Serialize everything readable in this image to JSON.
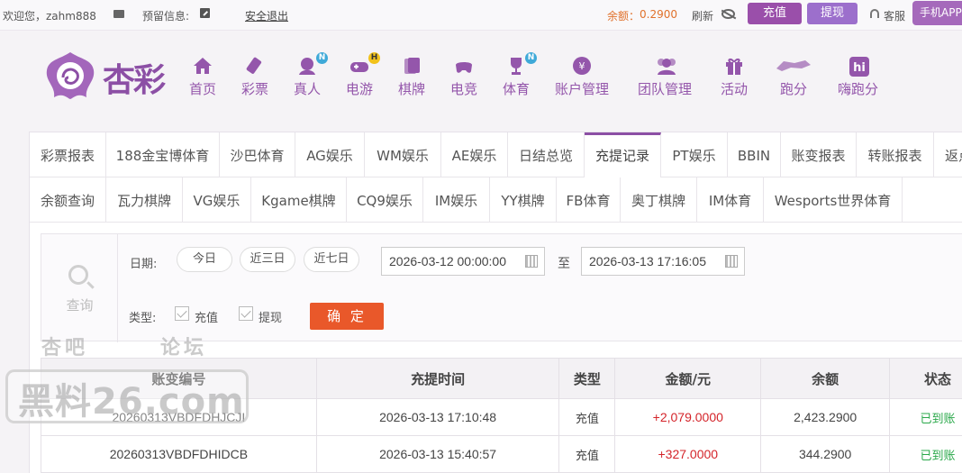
{
  "topbar": {
    "welcome": "欢迎您，zahm888",
    "reserve_label": "预留信息:",
    "logout": "安全退出",
    "balance_label": "余额：",
    "balance_value": "0.2900",
    "refresh": "刷新",
    "recharge": "充值",
    "withdraw": "提现",
    "service": "客服",
    "app": "手机APP"
  },
  "brand": {
    "name": "杏彩"
  },
  "nav": [
    {
      "label": "首页",
      "icon": "home-icon"
    },
    {
      "label": "彩票",
      "icon": "lottery-ticket-icon"
    },
    {
      "label": "真人",
      "icon": "live-dealer-icon",
      "badge": "N"
    },
    {
      "label": "电游",
      "icon": "gamepad-icon",
      "badge": "H"
    },
    {
      "label": "棋牌",
      "icon": "cards-icon"
    },
    {
      "label": "电竞",
      "icon": "esports-icon"
    },
    {
      "label": "体育",
      "icon": "trophy-icon",
      "badge": "N"
    },
    {
      "label": "账户管理",
      "icon": "account-icon"
    },
    {
      "label": "团队管理",
      "icon": "team-icon"
    },
    {
      "label": "活动",
      "icon": "gift-icon"
    },
    {
      "label": "跑分",
      "icon": "running-icon"
    },
    {
      "label": "嗨跑分",
      "icon": "hi-icon"
    }
  ],
  "tabs_row1": [
    "彩票报表",
    "188金宝博体育",
    "沙巴体育",
    "AG娱乐",
    "WM娱乐",
    "AE娱乐",
    "日结总览",
    "充提记录",
    "PT娱乐",
    "BBIN",
    "账变报表",
    "转账报表",
    "返点"
  ],
  "tabs_row2": [
    "余额查询",
    "瓦力棋牌",
    "VG娱乐",
    "Kgame棋牌",
    "CQ9娱乐",
    "IM娱乐",
    "YY棋牌",
    "FB体育",
    "奥丁棋牌",
    "IM体育",
    "Wesports世界体育"
  ],
  "active_tab": "充提记录",
  "search": {
    "side_label": "查询",
    "date_label": "日期:",
    "quick_ranges": [
      "今日",
      "近三日",
      "近七日"
    ],
    "start": "2026-03-12 00:00:00",
    "to": "至",
    "end": "2026-03-13 17:16:05",
    "type_label": "类型:",
    "types": [
      "充值",
      "提现"
    ],
    "confirm": "确 定"
  },
  "table": {
    "headers": [
      "账变编号",
      "充提时间",
      "类型",
      "金额/元",
      "余额",
      "状态"
    ],
    "rows": [
      [
        "20260313VBDFDHJCJI",
        "2026-03-13 17:10:48",
        "充值",
        "+2,079.0000",
        "2,423.2900",
        "已到账"
      ],
      [
        "20260313VBDFDHIDCB",
        "2026-03-13 15:40:57",
        "充值",
        "+327.0000",
        "344.2900",
        "已到账"
      ]
    ]
  },
  "watermark": {
    "top_left": "杏吧",
    "top_right": "论坛",
    "main": "黑料26.com"
  },
  "colors": {
    "brand": "#8c4fa5",
    "confirm": "#e9582a",
    "balance": "#e0712b",
    "amount": "#d4242a",
    "status": "#2aa84a"
  }
}
